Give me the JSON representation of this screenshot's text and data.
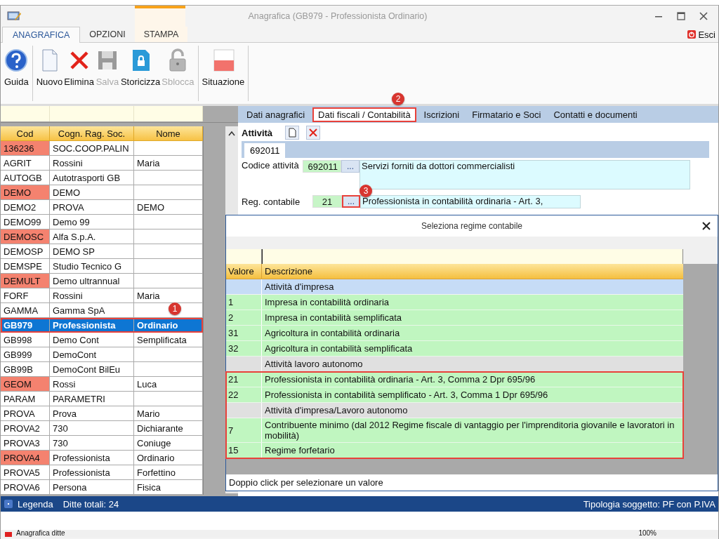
{
  "window": {
    "title": "Anagrafica (GB979 - Professionista Ordinario)"
  },
  "ribbon_tabs": [
    {
      "label": "ANAGRAFICA",
      "selected": true
    },
    {
      "label": "OPZIONI",
      "selected": false
    },
    {
      "label": "STAMPA",
      "selected": false,
      "contextual": true
    }
  ],
  "exit_button": {
    "label": "Esci"
  },
  "toolbar": [
    {
      "items": [
        {
          "label": "Guida",
          "disabled": false
        }
      ]
    },
    {
      "items": [
        {
          "label": "Nuovo",
          "disabled": false
        },
        {
          "label": "Elimina",
          "disabled": false
        },
        {
          "label": "Salva",
          "disabled": true
        },
        {
          "label": "Storicizza",
          "disabled": false
        },
        {
          "label": "Sblocca",
          "disabled": true
        }
      ]
    },
    {
      "items": [
        {
          "label": "Situazione",
          "disabled": false
        }
      ]
    }
  ],
  "company_grid": {
    "columns": [
      "Cod",
      "Cogn. Rag. Soc.",
      "Nome"
    ],
    "rows": [
      {
        "cod": "136236",
        "surname": "SOC.COOP.PALIN",
        "flagged": true,
        "selected": false
      },
      {
        "cod": "AGRIT",
        "surname": "Rossini",
        "name": "Maria",
        "flagged": false,
        "selected": false
      },
      {
        "cod": "AUTOGB",
        "surname": "Autotrasporti GB",
        "flagged": false,
        "selected": false
      },
      {
        "cod": "DEMO",
        "surname": "DEMO",
        "flagged": true,
        "selected": false
      },
      {
        "cod": "DEMO2",
        "surname": "PROVA",
        "name": "DEMO",
        "flagged": false,
        "selected": false
      },
      {
        "cod": "DEMO99",
        "surname": "Demo 99",
        "flagged": false,
        "selected": false
      },
      {
        "cod": "DEMOSC",
        "surname": "Alfa S.p.A.",
        "flagged": true,
        "selected": false
      },
      {
        "cod": "DEMOSP",
        "surname": "DEMO SP",
        "flagged": false,
        "selected": false
      },
      {
        "cod": "DEMSPE",
        "surname": "Studio Tecnico G",
        "flagged": false,
        "selected": false
      },
      {
        "cod": "DEMULT",
        "surname": "Demo ultrannual",
        "flagged": true,
        "selected": false
      },
      {
        "cod": "FORF",
        "surname": "Rossini",
        "name": "Maria",
        "flagged": false,
        "selected": false
      },
      {
        "cod": "GAMMA",
        "surname": "Gamma SpA",
        "flagged": false,
        "selected": false,
        "badge": "1"
      },
      {
        "cod": "GB979",
        "surname": "Professionista",
        "name": "Ordinario",
        "flagged": false,
        "selected": true,
        "outlined": true
      },
      {
        "cod": "GB998",
        "surname": "Demo Cont",
        "name": "Semplificata",
        "flagged": false,
        "selected": false
      },
      {
        "cod": "GB999",
        "surname": "DemoCont",
        "flagged": false,
        "selected": false
      },
      {
        "cod": "GB99B",
        "surname": "DemoCont BilEu",
        "flagged": false,
        "selected": false
      },
      {
        "cod": "GEOM",
        "surname": "Rossi",
        "name": "Luca",
        "flagged": true,
        "selected": false
      },
      {
        "cod": "PARAM",
        "surname": "PARAMETRI",
        "flagged": false,
        "selected": false
      },
      {
        "cod": "PROVA",
        "surname": "Prova",
        "name": "Mario",
        "flagged": false,
        "selected": false
      },
      {
        "cod": "PROVA2",
        "surname": "730",
        "name": "Dichiarante",
        "flagged": false,
        "selected": false
      },
      {
        "cod": "PROVA3",
        "surname": "730",
        "name": "Coniuge",
        "flagged": false,
        "selected": false
      },
      {
        "cod": "PROVA4",
        "surname": "Professionista",
        "name": "Ordinario",
        "flagged": true,
        "selected": false
      },
      {
        "cod": "PROVA5",
        "surname": "Professionista",
        "name": "Forfettino",
        "flagged": false,
        "selected": false
      },
      {
        "cod": "PROVA6",
        "surname": "Persona",
        "name": "Fisica",
        "flagged": false,
        "selected": false
      }
    ]
  },
  "section_tabs": [
    {
      "label": "Dati anagrafici",
      "selected": false
    },
    {
      "label": "Dati fiscali / Contabilità",
      "selected": true,
      "outlined": true,
      "badge": "2"
    },
    {
      "label": "Iscrizioni",
      "selected": false
    },
    {
      "label": "Firmatario e Soci",
      "selected": false
    },
    {
      "label": "Contatti e documenti",
      "selected": false
    }
  ],
  "activity": {
    "title": "Attività",
    "tabs": [
      {
        "label": "692011",
        "selected": true
      }
    ],
    "fields": [
      {
        "label": "Codice attività",
        "code": "692011",
        "button": "...",
        "description": "Servizi forniti da dottori commercialisti",
        "tall": true
      },
      {
        "label": "Reg. contabile",
        "code": "21",
        "button": "...",
        "description": "Professionista in contabilità ordinaria - Art. 3,",
        "tall": false,
        "outlined": true,
        "badge": "3"
      }
    ]
  },
  "dialog": {
    "title": "Seleziona regime contabile",
    "columns": [
      "Valore",
      "Descrizione"
    ],
    "rows": [
      {
        "kind": "group",
        "description": "Attività d'impresa",
        "selected": true,
        "outlined": false
      },
      {
        "kind": "value",
        "value": "1",
        "description": "Impresa  in contabilità ordinaria",
        "selected": false,
        "outlined": false
      },
      {
        "kind": "value",
        "value": "2",
        "description": "Impresa  in contabilità semplificata",
        "selected": false,
        "outlined": false
      },
      {
        "kind": "value",
        "value": "31",
        "description": "Agricoltura in contabilità ordinaria",
        "selected": false,
        "outlined": false
      },
      {
        "kind": "value",
        "value": "32",
        "description": "Agricoltura in contabilità semplificata",
        "selected": false,
        "outlined": false
      },
      {
        "kind": "group",
        "description": "Attività lavoro autonomo",
        "selected": false,
        "outlined": false
      },
      {
        "kind": "value",
        "value": "21",
        "description": "Professionista in contabilità ordinaria - Art. 3, Comma 2 Dpr 695/96",
        "selected": false,
        "outlined": true
      },
      {
        "kind": "value",
        "value": "22",
        "description": "Professionista in contabilità semplificato - Art. 3, Comma 1 Dpr 695/96",
        "selected": false,
        "outlined": true
      },
      {
        "kind": "group",
        "description": "Attività d'impresa/Lavoro autonomo",
        "selected": false,
        "outlined": true
      },
      {
        "kind": "value",
        "value": "7",
        "description": "Contribuente minimo (dal 2012 Regime fiscale di vantaggio per l'imprenditoria giovanile e lavoratori in mobilità)",
        "selected": false,
        "outlined": true
      },
      {
        "kind": "value",
        "value": "15",
        "description": "Regime forfetario",
        "selected": false,
        "outlined": true
      }
    ],
    "footer": "Doppio click per selezionare un valore"
  },
  "status_bar": {
    "legend": "Legenda",
    "total": "Ditte totali: 24",
    "subject_type": "Tipologia soggetto: PF con P.IVA"
  },
  "bottom_bar": {
    "document": "Anagrafica ditte",
    "zoom": "100%"
  }
}
